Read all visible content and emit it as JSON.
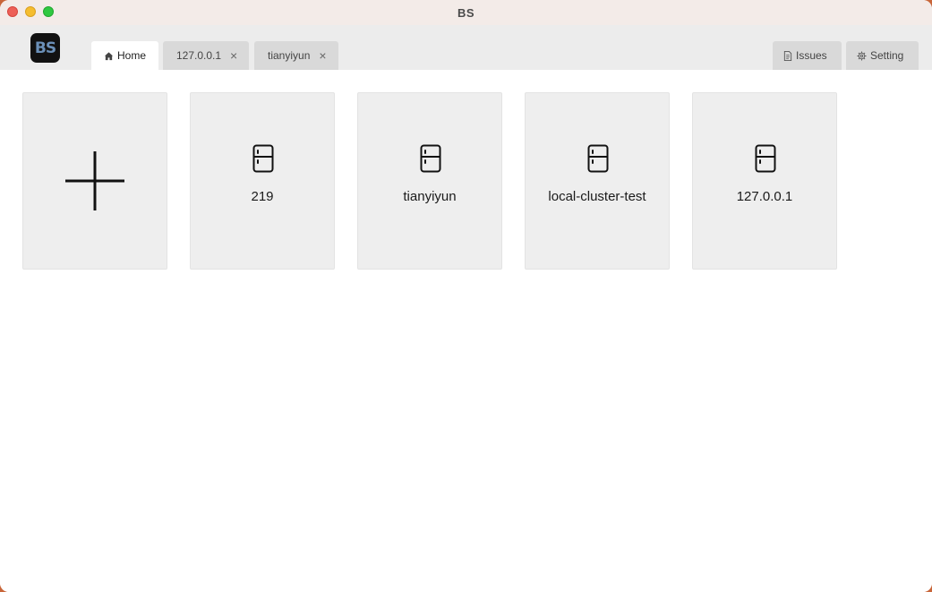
{
  "window": {
    "title": "BS"
  },
  "logo": {
    "text": "BS"
  },
  "tabs": [
    {
      "label": "Home",
      "icon": "home-icon",
      "active": true
    },
    {
      "label": "127.0.0.1",
      "closable": true
    },
    {
      "label": "tianyiyun",
      "closable": true
    }
  ],
  "right_buttons": [
    {
      "label": "Issues",
      "icon": "document-icon"
    },
    {
      "label": "Setting",
      "icon": "gear-icon"
    }
  ],
  "add_card": {
    "icon": "plus-icon"
  },
  "servers": [
    {
      "name": "219",
      "icon": "server-icon"
    },
    {
      "name": "tianyiyun",
      "icon": "server-icon"
    },
    {
      "name": "local-cluster-test",
      "icon": "server-icon"
    },
    {
      "name": "127.0.0.1",
      "icon": "server-icon"
    }
  ],
  "colors": {
    "titlebar": "#f3ebe8",
    "tabbar": "#ececec",
    "card": "#eeeeee"
  }
}
